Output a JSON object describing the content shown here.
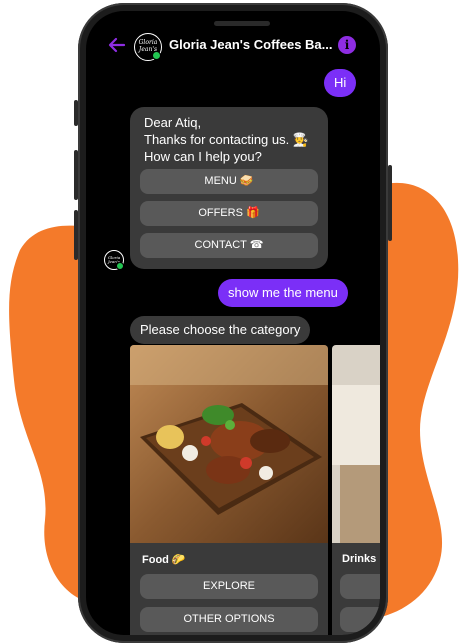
{
  "colors": {
    "accent": "#7b2ff7",
    "blob": "#f47a2a",
    "bubble_in": "#3a3a3a",
    "quick_reply": "#595959",
    "online": "#23c552"
  },
  "header": {
    "title": "Gloria Jean's Coffees Ba...",
    "logo_text": "Gloria Jean's",
    "back_icon": "arrow-left-icon",
    "info_icon": "info-icon",
    "info_glyph": "i"
  },
  "messages": {
    "user_hi": "Hi",
    "greeting": "Dear Atiq,\nThanks for contacting us. 🧑‍🍳\nHow can I help you?",
    "quick_replies": [
      {
        "label": "MENU 🥪"
      },
      {
        "label": "OFFERS 🎁"
      },
      {
        "label": "CONTACT ☎"
      }
    ],
    "user_menu": "show me the menu",
    "choose_category": "Please choose the category"
  },
  "carousel": {
    "cards": [
      {
        "title": "Food 🌮",
        "buttons": [
          "EXPLORE",
          "OTHER OPTIONS"
        ]
      },
      {
        "title": "Drinks"
      }
    ]
  }
}
